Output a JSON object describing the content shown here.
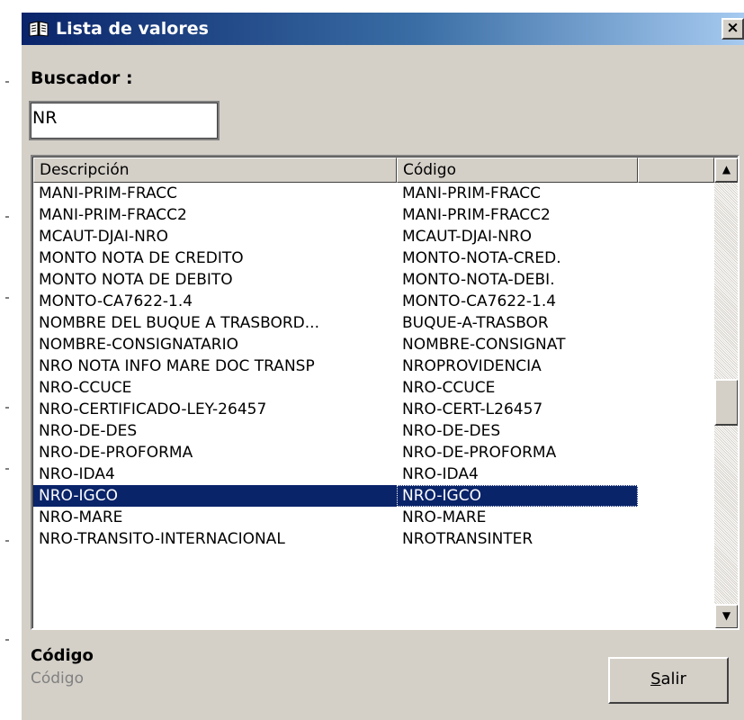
{
  "window": {
    "title": "Lista de valores",
    "close_glyph": "×",
    "icon": "book-icon"
  },
  "search": {
    "label": "Buscador :",
    "value": "NR"
  },
  "list": {
    "columns": [
      "Descripción",
      "Código",
      ""
    ],
    "selected_index": 14,
    "rows": [
      {
        "descripcion": "MANI-PRIM-FRACC",
        "codigo": "MANI-PRIM-FRACC"
      },
      {
        "descripcion": "MANI-PRIM-FRACC2",
        "codigo": "MANI-PRIM-FRACC2"
      },
      {
        "descripcion": "MCAUT-DJAI-NRO",
        "codigo": "MCAUT-DJAI-NRO"
      },
      {
        "descripcion": "MONTO NOTA DE CREDITO",
        "codigo": "MONTO-NOTA-CRED."
      },
      {
        "descripcion": "MONTO NOTA DE DEBITO",
        "codigo": "MONTO-NOTA-DEBI."
      },
      {
        "descripcion": "MONTO-CA7622-1.4",
        "codigo": "MONTO-CA7622-1.4"
      },
      {
        "descripcion": "NOMBRE DEL BUQUE A TRASBORD...",
        "codigo": "BUQUE-A-TRASBOR"
      },
      {
        "descripcion": "NOMBRE-CONSIGNATARIO",
        "codigo": "NOMBRE-CONSIGNAT"
      },
      {
        "descripcion": "NRO NOTA INFO MARE DOC TRANSP",
        "codigo": "NROPROVIDENCIA"
      },
      {
        "descripcion": "NRO-CCUCE",
        "codigo": "NRO-CCUCE"
      },
      {
        "descripcion": "NRO-CERTIFICADO-LEY-26457",
        "codigo": "NRO-CERT-L26457"
      },
      {
        "descripcion": "NRO-DE-DES",
        "codigo": "NRO-DE-DES"
      },
      {
        "descripcion": "NRO-DE-PROFORMA",
        "codigo": "NRO-DE-PROFORMA"
      },
      {
        "descripcion": "NRO-IDA4",
        "codigo": "NRO-IDA4"
      },
      {
        "descripcion": "NRO-IGCO",
        "codigo": "NRO-IGCO"
      },
      {
        "descripcion": "NRO-MARE",
        "codigo": "NRO-MARE"
      },
      {
        "descripcion": "NRO-TRANSITO-INTERNACIONAL",
        "codigo": "NROTRANSINTER"
      }
    ]
  },
  "scrollbar": {
    "up_glyph": "▲",
    "down_glyph": "▼"
  },
  "footer": {
    "field_title": "Código",
    "field_subtitle": "Código",
    "exit_button_accel": "S",
    "exit_button_rest": "alir"
  },
  "colors": {
    "title_gradient_start": "#0a246a",
    "title_gradient_end": "#a6caf0",
    "dialog_face": "#d4d0c8",
    "selection": "#0a246a"
  }
}
